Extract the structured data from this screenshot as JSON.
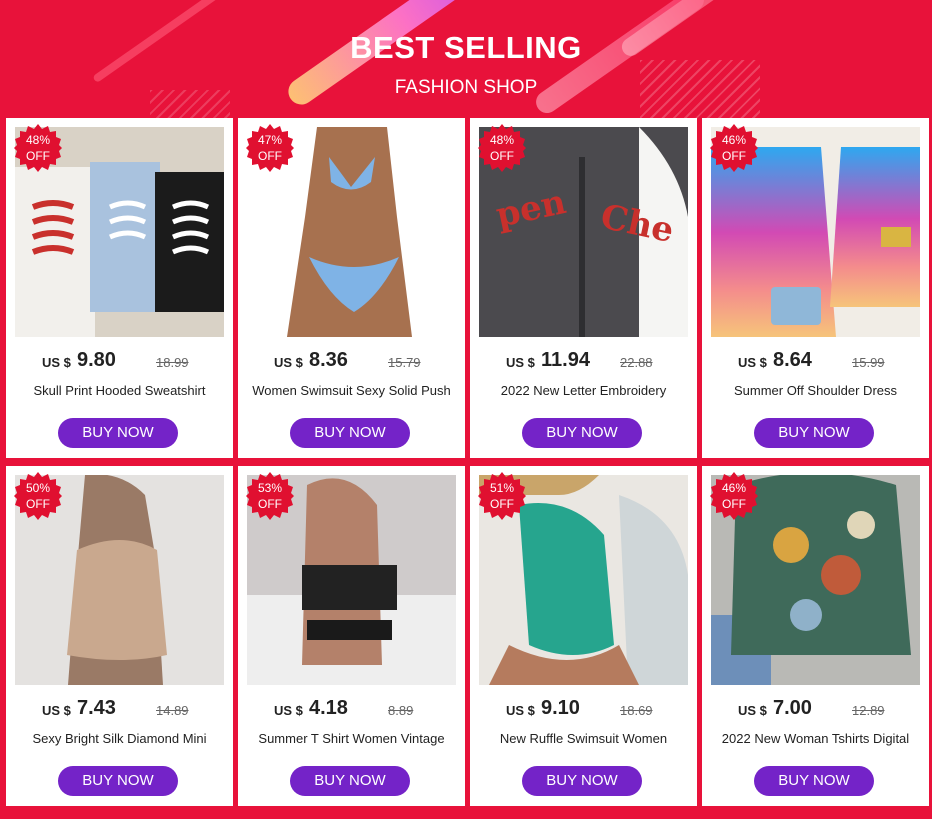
{
  "header": {
    "title": "BEST SELLING",
    "subtitle": "FASHION SHOP"
  },
  "products": [
    {
      "discount": "48%",
      "off": "OFF",
      "currency": "US $",
      "price": "9.80",
      "old_price": "18.99",
      "name": "Skull Print  Hooded Sweatshirt",
      "buy": "BUY NOW"
    },
    {
      "discount": "47%",
      "off": "OFF",
      "currency": "US $",
      "price": "8.36",
      "old_price": "15.79",
      "name": "Women Swimsuit     Sexy Solid Push",
      "buy": "BUY NOW"
    },
    {
      "discount": "48%",
      "off": "OFF",
      "currency": "US $",
      "price": "11.94",
      "old_price": "22.88",
      "name": "2022 New Letter  Embroidery",
      "buy": "BUY NOW"
    },
    {
      "discount": "46%",
      "off": "OFF",
      "currency": "US $",
      "price": "8.64",
      "old_price": "15.99",
      "name": "Summer Off Shoulder Dress",
      "buy": "BUY NOW"
    },
    {
      "discount": "50%",
      "off": "OFF",
      "currency": "US $",
      "price": "7.43",
      "old_price": "14.89",
      "name": "Sexy  Bright Silk  Diamond Mini",
      "buy": "BUY NOW"
    },
    {
      "discount": "53%",
      "off": "OFF",
      "currency": "US $",
      "price": "4.18",
      "old_price": "8.89",
      "name": "Summer T Shirt  Women Vintage",
      "buy": "BUY NOW"
    },
    {
      "discount": "51%",
      "off": "OFF",
      "currency": "US $",
      "price": "9.10",
      "old_price": "18.69",
      "name": "New Ruffle Swimsuit Women",
      "buy": "BUY NOW"
    },
    {
      "discount": "46%",
      "off": "OFF",
      "currency": "US $",
      "price": "7.00",
      "old_price": "12.89",
      "name": "2022 New Woman Tshirts Digital",
      "buy": "BUY NOW"
    }
  ],
  "colors": {
    "background": "#e8123a",
    "badge": "#e01030",
    "button": "#7423c8"
  },
  "images": [
    "skull-hoodies-photo",
    "blue-bikini-photo",
    "gray-letter-hoodie-photo",
    "gradient-off-shoulder-dress-photo",
    "beige-silk-mini-dress-photo",
    "black-crop-tshirt-photo",
    "green-ruffle-swimsuit-photo",
    "cat-print-tshirt-photo"
  ]
}
